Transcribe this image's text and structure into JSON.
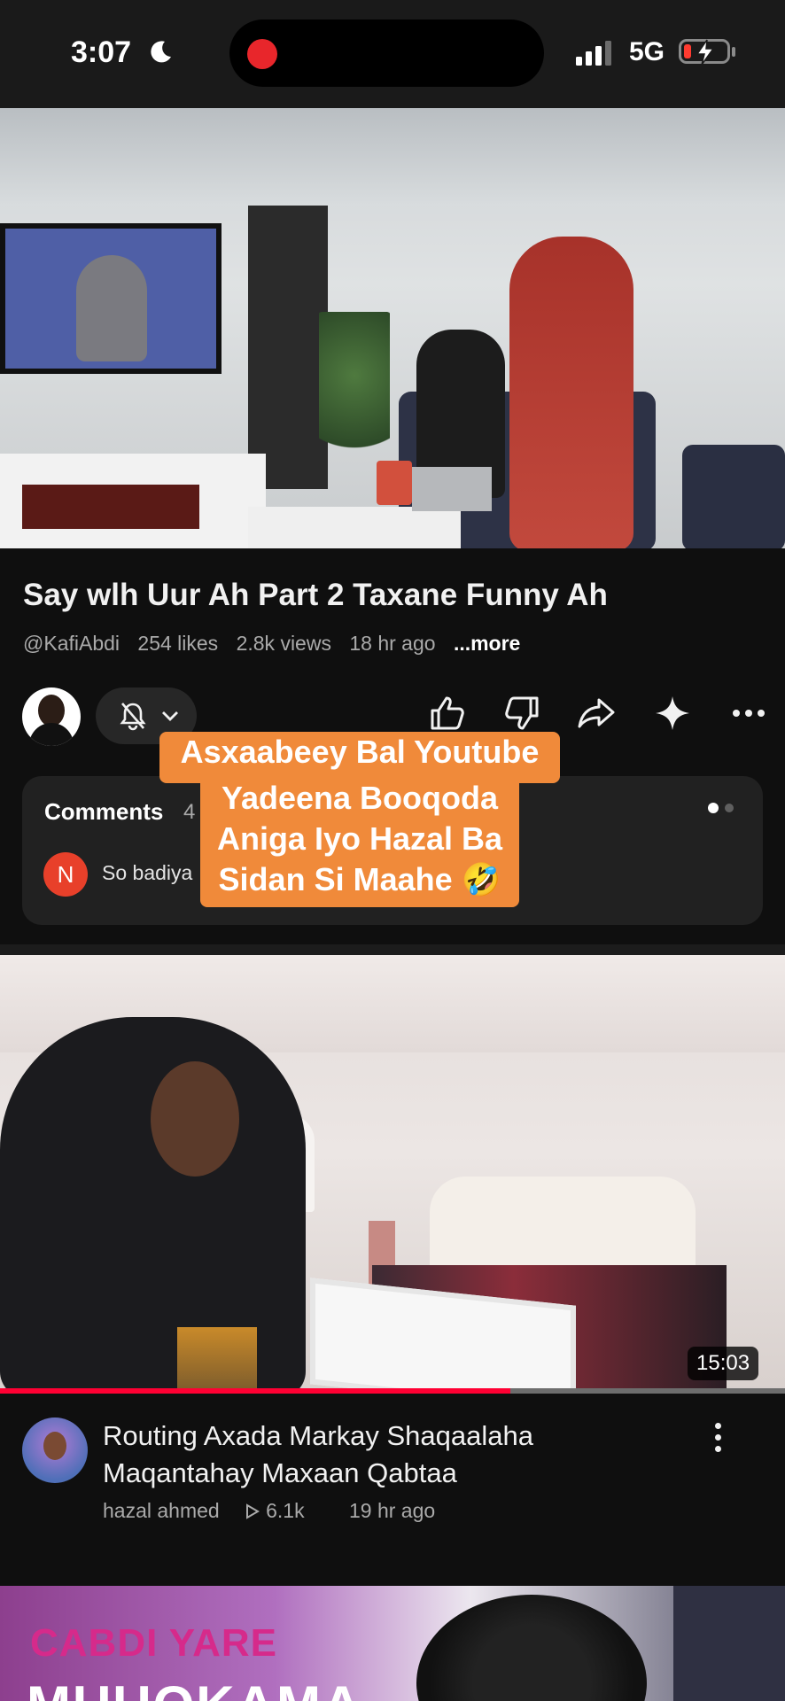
{
  "status_bar": {
    "time": "3:07",
    "network": "5G",
    "recording": true,
    "battery_level": 0.1,
    "battery_color": "#ff3b30"
  },
  "video": {
    "title": "Say wlh Uur Ah Part 2 Taxane Funny Ah",
    "channel": "@KafiAbdi",
    "likes": "254 likes",
    "views": "2.8k views",
    "age": "18 hr ago",
    "more_label": "...more"
  },
  "actions": {
    "icons": [
      "bell-off-icon",
      "chevron-down-icon",
      "thumbs-up-icon",
      "thumbs-down-icon",
      "share-icon",
      "sparkle-icon",
      "more-horizontal-icon"
    ]
  },
  "caption_overlay": {
    "line1": "Asxaabeey Bal Youtube",
    "line2": "Yadeena Booqoda",
    "line3": "Aniga Iyo Hazal Ba",
    "line4": "Sidan Si Maahe 🤣",
    "color": "#f08a3a"
  },
  "comments": {
    "heading": "Comments",
    "count": "4",
    "first_comment_avatar_letter": "N",
    "first_comment_text": "So badiya"
  },
  "next_video": {
    "title": "Routing Axada Markay Shaqaalaha Maqantahay Maxaan Qabtaa",
    "channel": "hazal ahmed",
    "views": "6.1k",
    "age": "19 hr ago",
    "duration": "15:03",
    "watched_fraction": 0.65,
    "progress_color": "#ff0033"
  },
  "third_video": {
    "thumb_text1": "CABDI YARE",
    "thumb_text2": "MUUQKAMA"
  }
}
